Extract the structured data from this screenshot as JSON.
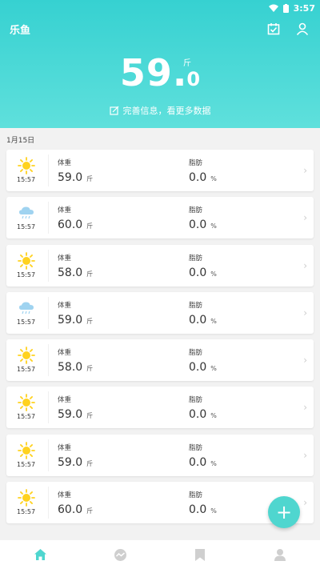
{
  "status": {
    "time": "3:57"
  },
  "app": {
    "title": "乐鱼"
  },
  "summary": {
    "weight_int": "59",
    "weight_dot": ".",
    "weight_dec": "0",
    "unit": "斤",
    "complete_info": "完善信息，看更多数据"
  },
  "date_label": "1月15日",
  "labels": {
    "weight": "体重",
    "fat": "脂肪",
    "weight_unit": "斤",
    "fat_unit": "%"
  },
  "records": [
    {
      "weather": "sunny",
      "time": "15:57",
      "weight": "59.0",
      "fat": "0.0"
    },
    {
      "weather": "rain",
      "time": "15:57",
      "weight": "60.0",
      "fat": "0.0"
    },
    {
      "weather": "sunny",
      "time": "15:57",
      "weight": "58.0",
      "fat": "0.0"
    },
    {
      "weather": "rain",
      "time": "15:57",
      "weight": "59.0",
      "fat": "0.0"
    },
    {
      "weather": "sunny",
      "time": "15:57",
      "weight": "58.0",
      "fat": "0.0"
    },
    {
      "weather": "sunny",
      "time": "15:57",
      "weight": "59.0",
      "fat": "0.0"
    },
    {
      "weather": "sunny",
      "time": "15:57",
      "weight": "59.0",
      "fat": "0.0"
    },
    {
      "weather": "sunny",
      "time": "15:57",
      "weight": "60.0",
      "fat": "0.0"
    }
  ],
  "fab": {
    "symbol": "+"
  },
  "nav": [
    {
      "icon": "home-icon",
      "active": true
    },
    {
      "icon": "trend-icon",
      "active": false
    },
    {
      "icon": "bookmark-icon",
      "active": false
    },
    {
      "icon": "profile-icon",
      "active": false
    }
  ],
  "colors": {
    "accent": "#36d1d1",
    "sun": "#ffd21f",
    "cloud": "#9fd3f0",
    "nav_active": "#4fd6cf",
    "nav_inactive": "#cfcfcf"
  }
}
